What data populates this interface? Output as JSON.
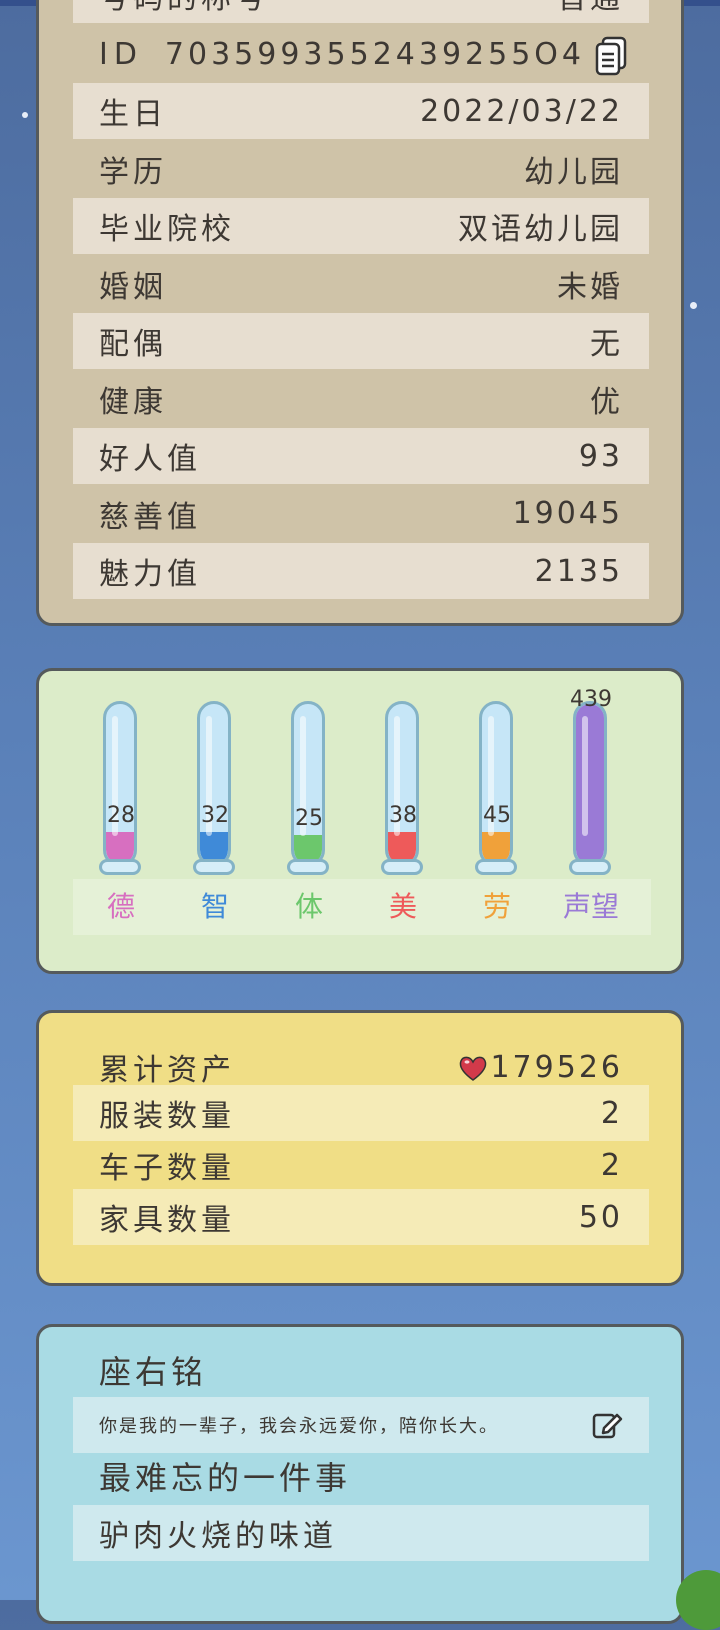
{
  "profile": {
    "partial_top": {
      "label": "号码的称号",
      "value": "普通"
    },
    "id_label": "ID",
    "id_value": "7035993552439255O4",
    "rows": [
      {
        "label": "生日",
        "value": "2022/03/22"
      },
      {
        "label": "学历",
        "value": "幼儿园"
      },
      {
        "label": "毕业院校",
        "value": "双语幼儿园"
      },
      {
        "label": "婚姻",
        "value": "未婚"
      },
      {
        "label": "配偶",
        "value": "无"
      },
      {
        "label": "健康",
        "value": "优"
      },
      {
        "label": "好人值",
        "value": "93"
      },
      {
        "label": "慈善值",
        "value": "19045"
      },
      {
        "label": "魅力值",
        "value": "2135"
      }
    ]
  },
  "stats": {
    "items": [
      {
        "label": "德",
        "value": "28",
        "color": "#d76fc0",
        "fill_fraction": 0.2
      },
      {
        "label": "智",
        "value": "32",
        "color": "#3f8ad8",
        "fill_fraction": 0.2
      },
      {
        "label": "体",
        "value": "25",
        "color": "#6cc76c",
        "fill_fraction": 0.18
      },
      {
        "label": "美",
        "value": "38",
        "color": "#ee5a5a",
        "fill_fraction": 0.2
      },
      {
        "label": "劳",
        "value": "45",
        "color": "#f0a13a",
        "fill_fraction": 0.2
      },
      {
        "label": "声望",
        "value": "439",
        "color": "#9a7ad6",
        "fill_fraction": 1.0
      }
    ]
  },
  "assets": {
    "total_label": "累计资产",
    "total_value": "179526",
    "rows": [
      {
        "label": "服装数量",
        "value": "2"
      },
      {
        "label": "车子数量",
        "value": "2"
      },
      {
        "label": "家具数量",
        "value": "50"
      }
    ]
  },
  "motto": {
    "title": "座右铭",
    "text": "你是我的一辈子，我会永远爱你，陪你长大。",
    "memorable_title": "最难忘的一件事",
    "memorable_text": "驴肉火烧的味道"
  },
  "colors": {
    "heart": "#d23a4a",
    "panel_border": "#555a5c"
  }
}
